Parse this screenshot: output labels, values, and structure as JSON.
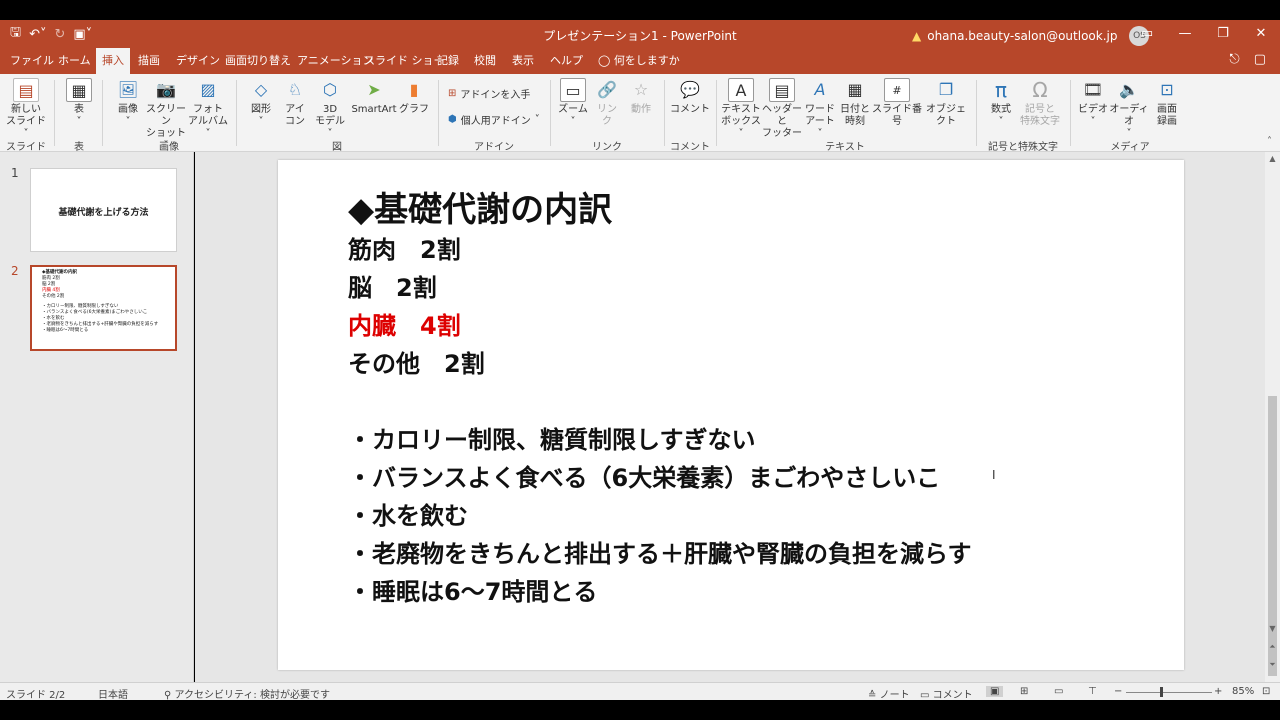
{
  "titlebar": {
    "title": "プレゼンテーション1 - PowerPoint",
    "account": "ohana.beauty-salon@outlook.jp",
    "avatar": "OS",
    "qat": [
      "save-icon",
      "undo-icon",
      "redo-icon",
      "present-icon"
    ]
  },
  "tabs": {
    "file": "ファイル",
    "home": "ホーム",
    "insert": "挿入",
    "draw": "描画",
    "design": "デザイン",
    "transitions": "画面切り替え",
    "animations": "アニメーション",
    "slideshow": "スライド ショー",
    "record": "記録",
    "review": "校閲",
    "view": "表示",
    "help": "ヘルプ",
    "tellme": "何をしますか"
  },
  "ribbon": {
    "new_slide": [
      "新しい",
      "スライド ˅"
    ],
    "table": [
      "表",
      "˅"
    ],
    "picture": [
      "画像",
      "˅"
    ],
    "screenshot": [
      "スクリーン",
      "ショット ˅"
    ],
    "photo_album": [
      "フォト",
      "アルバム ˅"
    ],
    "shapes": [
      "図形",
      "˅"
    ],
    "icons": [
      "アイ",
      "コン"
    ],
    "model3d": [
      "3D",
      "モデル ˅"
    ],
    "smartart": "SmartArt",
    "chart": "グラフ",
    "get_addins": "アドインを入手",
    "my_addins": "個人用アドイン",
    "zoom": [
      "ズーム",
      "˅"
    ],
    "link": [
      "リン",
      "ク"
    ],
    "action": "動作",
    "comment": "コメント",
    "textbox": [
      "テキスト",
      "ボックス ˅"
    ],
    "header_footer": [
      "ヘッダーと",
      "フッター"
    ],
    "wordart": [
      "ワード",
      "アート ˅"
    ],
    "datetime": [
      "日付と",
      "時刻"
    ],
    "slide_number": "スライド番号",
    "object": "オブジェクト",
    "equation": [
      "数式",
      "˅"
    ],
    "symbol": [
      "記号と",
      "特殊文字"
    ],
    "video": [
      "ビデオ",
      "˅"
    ],
    "audio": [
      "オーディオ",
      "˅"
    ],
    "screen_recording": [
      "画面",
      "録画"
    ],
    "groups": {
      "slides": "スライド",
      "tables": "表",
      "images": "画像",
      "illustrations": "図",
      "addins": "アドイン",
      "links": "リンク",
      "comments": "コメント",
      "text": "テキスト",
      "symbols": "記号と特殊文字",
      "media": "メディア"
    }
  },
  "thumbnails": {
    "items": [
      {
        "number": "1",
        "title": "基礎代謝を上げる方法"
      },
      {
        "number": "2",
        "lines": [
          "◆基礎代謝の内訳",
          "筋肉 2割",
          "脳 2割",
          "内臓 4割",
          "その他 2割",
          "",
          "・カロリー制限、糖質制限しすぎない",
          "・バランスよく食べる(6大栄養素)まごわやさしいこ",
          "・水を飲む",
          "・老廃物をきちんと排出する+肝臓や腎臓の負担を減らす",
          "・睡眠は6〜7時間とる"
        ]
      }
    ]
  },
  "slide": {
    "heading": "◆基礎代謝の内訳",
    "line1": "筋肉　2割",
    "line2": "脳　2割",
    "line3": "内臓　4割",
    "line4": "その他　2割",
    "bullet1": "・カロリー制限、糖質制限しすぎない",
    "bullet2": "・バランスよく食べる（6大栄養素）まごわやさしいこ",
    "bullet3": "・水を飲む",
    "bullet4": "・老廃物をきちんと排出する＋肝臓や腎臓の負担を減らす",
    "bullet5": "・睡眠は6〜7時間とる",
    "accent_color": "#dd0000"
  },
  "status": {
    "slide_count": "スライド 2/2",
    "language": "日本語",
    "accessibility": "アクセシビリティ: 検討が必要です",
    "notes": "ノート",
    "comments": "コメント",
    "zoom": "85%"
  },
  "colors": {
    "brand": "#b7472a",
    "selection": "#b7472a"
  }
}
